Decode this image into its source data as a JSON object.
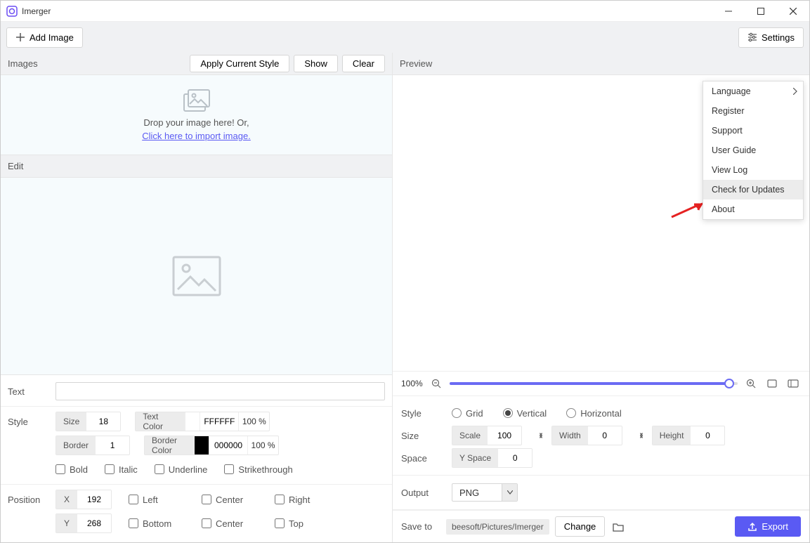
{
  "app": {
    "title": "Imerger"
  },
  "toolbar": {
    "add_image": "Add Image",
    "settings": "Settings"
  },
  "settings_menu": {
    "language": "Language",
    "register": "Register",
    "support": "Support",
    "user_guide": "User Guide",
    "view_log": "View Log",
    "check_updates": "Check for Updates",
    "about": "About"
  },
  "panels": {
    "images": {
      "title": "Images",
      "apply": "Apply Current Style",
      "show": "Show",
      "clear": "Clear",
      "drop_text": "Drop your image here! Or,",
      "drop_link": "Click here to import image."
    },
    "edit": {
      "title": "Edit"
    },
    "preview": {
      "title": "Preview"
    }
  },
  "text_row": {
    "label": "Text",
    "value": ""
  },
  "style_row": {
    "label": "Style",
    "size_lbl": "Size",
    "size_val": "18",
    "border_lbl": "Border",
    "border_val": "1",
    "textcolor_lbl": "Text Color",
    "textcolor_val": "FFFFFF",
    "textcolor_pct": "100 %",
    "bordercolor_lbl": "Border Color",
    "bordercolor_val": "000000",
    "bordercolor_pct": "100 %",
    "bold": "Bold",
    "italic": "Italic",
    "underline": "Underline",
    "strike": "Strikethrough"
  },
  "position_row": {
    "label": "Position",
    "x_lbl": "X",
    "x_val": "192",
    "y_lbl": "Y",
    "y_val": "268",
    "left": "Left",
    "center": "Center",
    "right": "Right",
    "bottom": "Bottom",
    "center2": "Center",
    "top": "Top"
  },
  "zoom": {
    "pct": "100%",
    "value": 100
  },
  "right_style": {
    "label": "Style",
    "grid": "Grid",
    "vertical": "Vertical",
    "horizontal": "Horizontal",
    "selected": "vertical"
  },
  "right_size": {
    "label": "Size",
    "scale_lbl": "Scale",
    "scale_val": "100",
    "width_lbl": "Width",
    "width_val": "0",
    "height_lbl": "Height",
    "height_val": "0"
  },
  "right_space": {
    "label": "Space",
    "yspace_lbl": "Y Space",
    "yspace_val": "0"
  },
  "output": {
    "label": "Output",
    "format": "PNG"
  },
  "save": {
    "label": "Save to",
    "path": "beesoft/Pictures/Imerger",
    "change": "Change",
    "export": "Export"
  }
}
